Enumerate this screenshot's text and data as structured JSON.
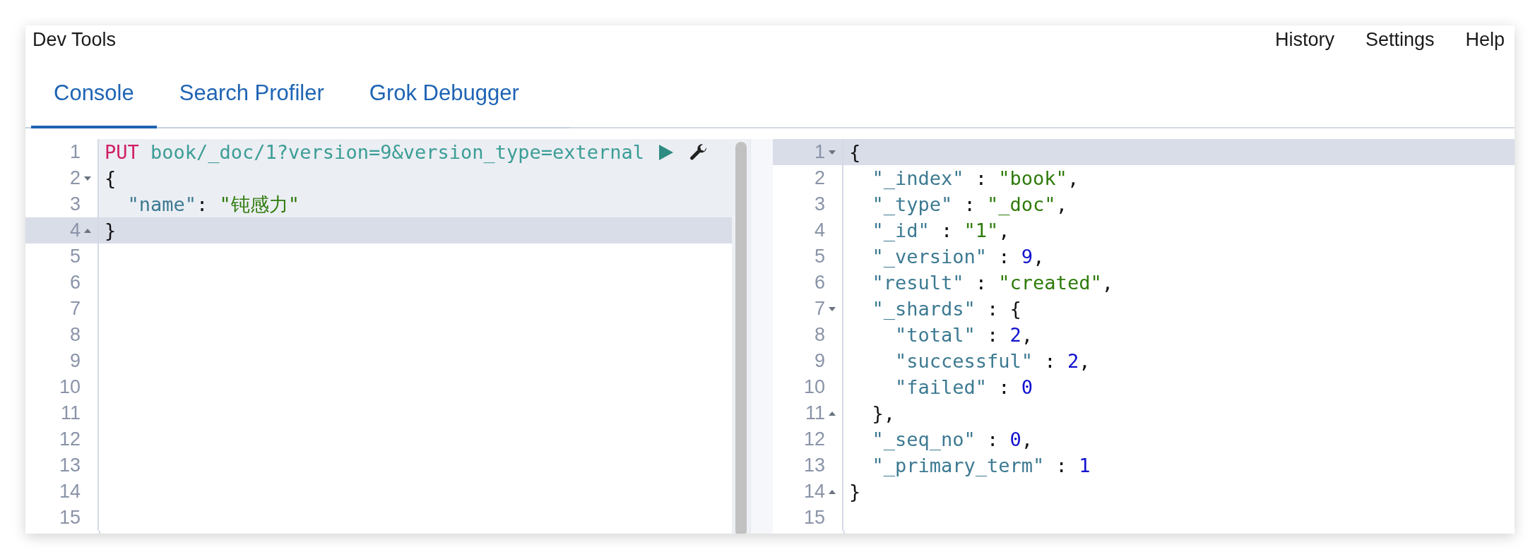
{
  "header": {
    "title": "Dev Tools",
    "links": [
      "History",
      "Settings",
      "Help"
    ]
  },
  "tabs": [
    {
      "label": "Console",
      "selected": true
    },
    {
      "label": "Search Profiler",
      "selected": false
    },
    {
      "label": "Grok Debugger",
      "selected": false
    }
  ],
  "request_editor": {
    "lines": [
      {
        "number": "1",
        "in_request": true,
        "cursor": false,
        "fold_start": false,
        "fold_end": false,
        "actions": true,
        "tokens": [
          {
            "kind": "method",
            "text": "PUT"
          },
          {
            "kind": "url",
            "text": " book/_doc/1?version=9&version_type=external"
          }
        ]
      },
      {
        "number": "2",
        "in_request": true,
        "cursor": false,
        "fold_start": true,
        "fold_end": false,
        "actions": false,
        "tokens": [
          {
            "kind": "punct",
            "text": "{"
          }
        ]
      },
      {
        "number": "3",
        "in_request": true,
        "cursor": false,
        "fold_start": false,
        "fold_end": false,
        "actions": false,
        "tokens": [
          {
            "kind": "key",
            "text": "  \"name\""
          },
          {
            "kind": "punct",
            "text": ": "
          },
          {
            "kind": "string",
            "text": "\"钝感力\""
          }
        ]
      },
      {
        "number": "4",
        "in_request": false,
        "cursor": true,
        "fold_start": false,
        "fold_end": true,
        "actions": false,
        "tokens": [
          {
            "kind": "punct",
            "text": "}"
          }
        ]
      },
      {
        "number": "5",
        "in_request": false,
        "cursor": false,
        "fold_start": false,
        "fold_end": false,
        "actions": false
      },
      {
        "number": "6",
        "in_request": false,
        "cursor": false,
        "fold_start": false,
        "fold_end": false,
        "actions": false
      },
      {
        "number": "7",
        "in_request": false,
        "cursor": false,
        "fold_start": false,
        "fold_end": false,
        "actions": false
      },
      {
        "number": "8",
        "in_request": false,
        "cursor": false,
        "fold_start": false,
        "fold_end": false,
        "actions": false
      },
      {
        "number": "9",
        "in_request": false,
        "cursor": false,
        "fold_start": false,
        "fold_end": false,
        "actions": false
      },
      {
        "number": "10",
        "in_request": false,
        "cursor": false,
        "fold_start": false,
        "fold_end": false,
        "actions": false
      },
      {
        "number": "11",
        "in_request": false,
        "cursor": false,
        "fold_start": false,
        "fold_end": false,
        "actions": false
      },
      {
        "number": "12",
        "in_request": false,
        "cursor": false,
        "fold_start": false,
        "fold_end": false,
        "actions": false
      },
      {
        "number": "13",
        "in_request": false,
        "cursor": false,
        "fold_start": false,
        "fold_end": false,
        "actions": false
      },
      {
        "number": "14",
        "in_request": false,
        "cursor": false,
        "fold_start": false,
        "fold_end": false,
        "actions": false
      },
      {
        "number": "15",
        "in_request": false,
        "cursor": false,
        "fold_start": false,
        "fold_end": false,
        "actions": false
      }
    ]
  },
  "response_editor": {
    "lines": [
      {
        "number": "1",
        "cursor": true,
        "fold_start": true,
        "fold_end": false,
        "tokens": [
          {
            "kind": "punct",
            "text": "{"
          }
        ]
      },
      {
        "number": "2",
        "cursor": false,
        "fold_start": false,
        "fold_end": false,
        "tokens": [
          {
            "kind": "key",
            "text": "  \"_index\""
          },
          {
            "kind": "punct",
            "text": " : "
          },
          {
            "kind": "string",
            "text": "\"book\""
          },
          {
            "kind": "punct",
            "text": ","
          }
        ]
      },
      {
        "number": "3",
        "cursor": false,
        "fold_start": false,
        "fold_end": false,
        "tokens": [
          {
            "kind": "key",
            "text": "  \"_type\""
          },
          {
            "kind": "punct",
            "text": " : "
          },
          {
            "kind": "string",
            "text": "\"_doc\""
          },
          {
            "kind": "punct",
            "text": ","
          }
        ]
      },
      {
        "number": "4",
        "cursor": false,
        "fold_start": false,
        "fold_end": false,
        "tokens": [
          {
            "kind": "key",
            "text": "  \"_id\""
          },
          {
            "kind": "punct",
            "text": " : "
          },
          {
            "kind": "string",
            "text": "\"1\""
          },
          {
            "kind": "punct",
            "text": ","
          }
        ]
      },
      {
        "number": "5",
        "cursor": false,
        "fold_start": false,
        "fold_end": false,
        "tokens": [
          {
            "kind": "key",
            "text": "  \"_version\""
          },
          {
            "kind": "punct",
            "text": " : "
          },
          {
            "kind": "number",
            "text": "9"
          },
          {
            "kind": "punct",
            "text": ","
          }
        ]
      },
      {
        "number": "6",
        "cursor": false,
        "fold_start": false,
        "fold_end": false,
        "tokens": [
          {
            "kind": "key",
            "text": "  \"result\""
          },
          {
            "kind": "punct",
            "text": " : "
          },
          {
            "kind": "string",
            "text": "\"created\""
          },
          {
            "kind": "punct",
            "text": ","
          }
        ]
      },
      {
        "number": "7",
        "cursor": false,
        "fold_start": true,
        "fold_end": false,
        "tokens": [
          {
            "kind": "key",
            "text": "  \"_shards\""
          },
          {
            "kind": "punct",
            "text": " : {"
          }
        ]
      },
      {
        "number": "8",
        "cursor": false,
        "fold_start": false,
        "fold_end": false,
        "tokens": [
          {
            "kind": "key",
            "text": "    \"total\""
          },
          {
            "kind": "punct",
            "text": " : "
          },
          {
            "kind": "number",
            "text": "2"
          },
          {
            "kind": "punct",
            "text": ","
          }
        ]
      },
      {
        "number": "9",
        "cursor": false,
        "fold_start": false,
        "fold_end": false,
        "tokens": [
          {
            "kind": "key",
            "text": "    \"successful\""
          },
          {
            "kind": "punct",
            "text": " : "
          },
          {
            "kind": "number",
            "text": "2"
          },
          {
            "kind": "punct",
            "text": ","
          }
        ]
      },
      {
        "number": "10",
        "cursor": false,
        "fold_start": false,
        "fold_end": false,
        "tokens": [
          {
            "kind": "key",
            "text": "    \"failed\""
          },
          {
            "kind": "punct",
            "text": " : "
          },
          {
            "kind": "number",
            "text": "0"
          }
        ]
      },
      {
        "number": "11",
        "cursor": false,
        "fold_start": false,
        "fold_end": true,
        "tokens": [
          {
            "kind": "punct",
            "text": "  },"
          }
        ]
      },
      {
        "number": "12",
        "cursor": false,
        "fold_start": false,
        "fold_end": false,
        "tokens": [
          {
            "kind": "key",
            "text": "  \"_seq_no\""
          },
          {
            "kind": "punct",
            "text": " : "
          },
          {
            "kind": "number",
            "text": "0"
          },
          {
            "kind": "punct",
            "text": ","
          }
        ]
      },
      {
        "number": "13",
        "cursor": false,
        "fold_start": false,
        "fold_end": false,
        "tokens": [
          {
            "kind": "key",
            "text": "  \"_primary_term\""
          },
          {
            "kind": "punct",
            "text": " : "
          },
          {
            "kind": "number",
            "text": "1"
          }
        ]
      },
      {
        "number": "14",
        "cursor": false,
        "fold_start": false,
        "fold_end": true,
        "tokens": [
          {
            "kind": "punct",
            "text": "}"
          }
        ]
      },
      {
        "number": "15",
        "cursor": false,
        "fold_start": false,
        "fold_end": false
      }
    ]
  }
}
